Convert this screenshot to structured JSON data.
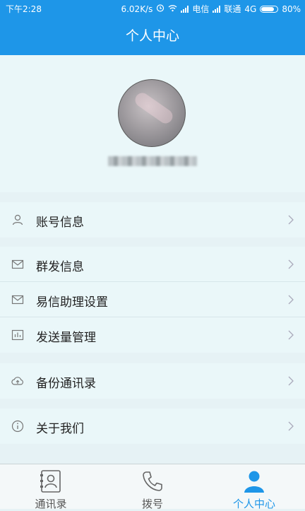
{
  "status_bar": {
    "time": "下午2:28",
    "net_speed": "6.02K/s",
    "carrier1": "电信",
    "carrier2": "联通",
    "network": "4G",
    "battery": "80%",
    "battery_level": 0.8
  },
  "header": {
    "title": "个人中心"
  },
  "profile": {
    "avatar": "avatar-photo-blurred"
  },
  "menu_groups": [
    [
      {
        "label": "账号信息",
        "icon": "person-icon"
      }
    ],
    [
      {
        "label": "群发信息",
        "icon": "mail-icon"
      },
      {
        "label": "易信助理设置",
        "icon": "mail-icon"
      },
      {
        "label": "发送量管理",
        "icon": "chart-icon"
      }
    ],
    [
      {
        "label": "备份通讯录",
        "icon": "cloud-upload-icon"
      }
    ],
    [
      {
        "label": "关于我们",
        "icon": "info-icon"
      }
    ]
  ],
  "bottom_nav": {
    "tabs": [
      {
        "label": "通讯录",
        "icon": "contacts-icon",
        "active": false
      },
      {
        "label": "拨号",
        "icon": "phone-icon",
        "active": false
      },
      {
        "label": "个人中心",
        "icon": "user-icon",
        "active": true
      }
    ]
  },
  "colors": {
    "accent": "#1e96e8",
    "background": "#e6f2f5",
    "row": "#eaf7f9"
  }
}
